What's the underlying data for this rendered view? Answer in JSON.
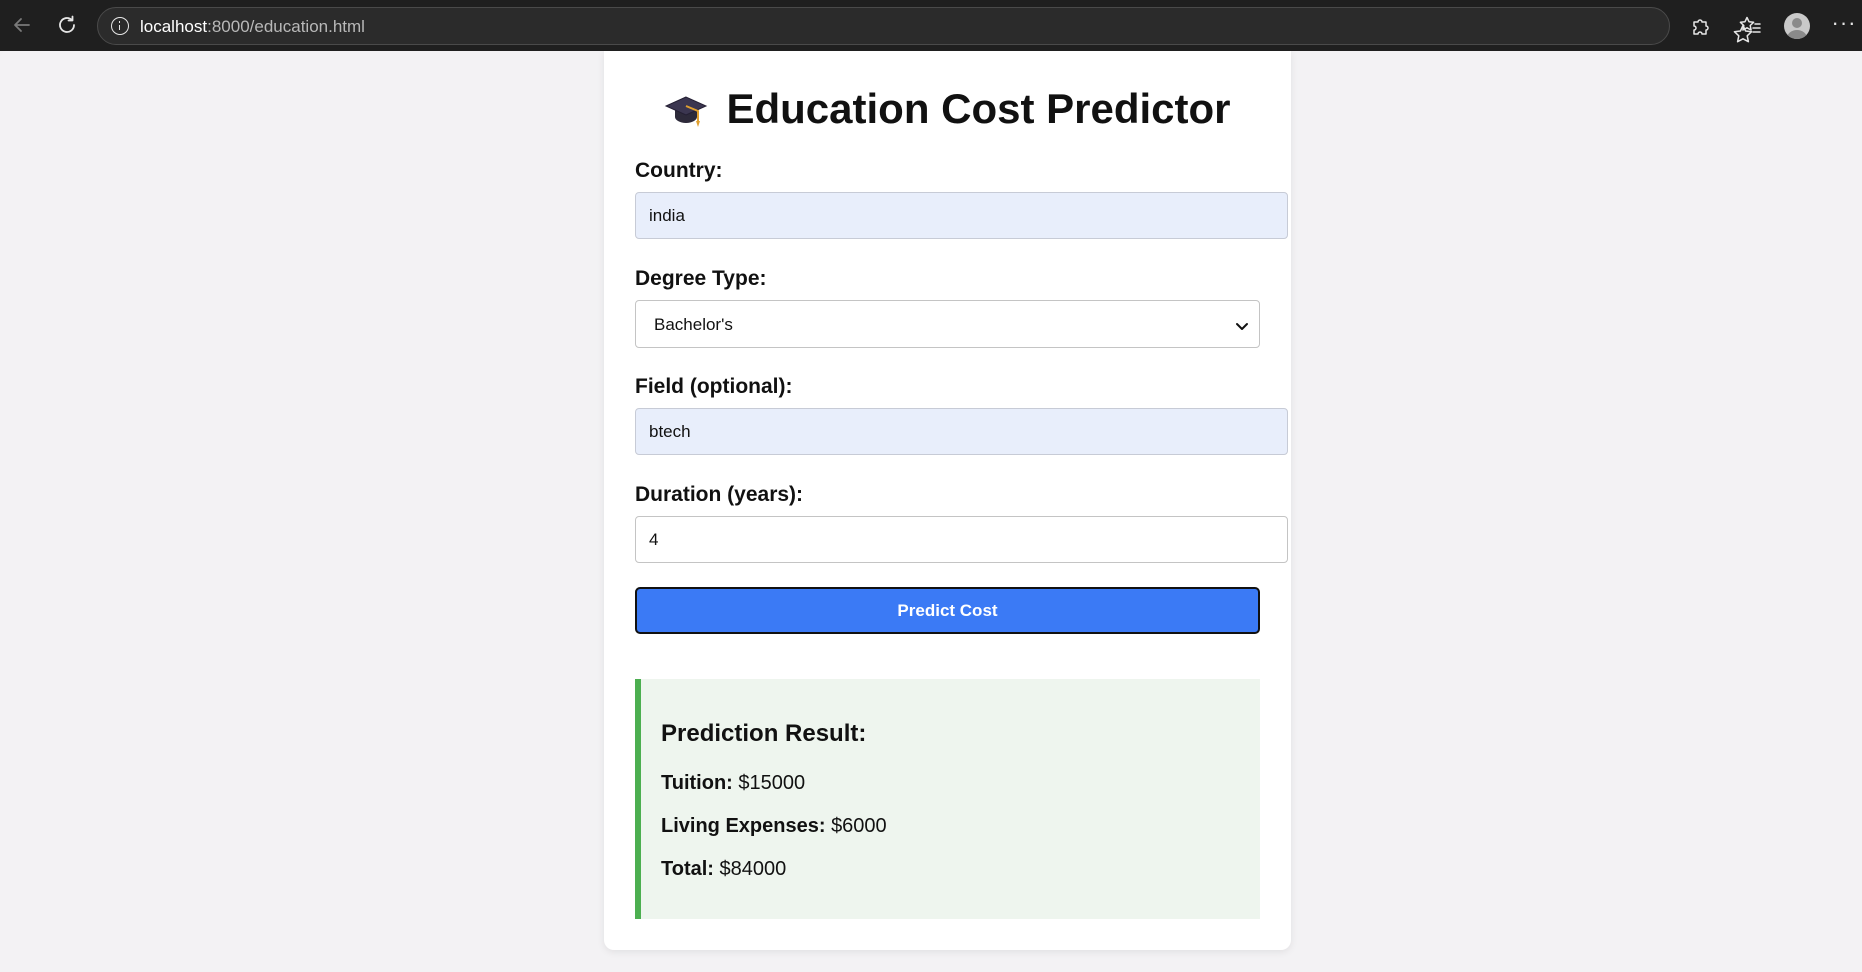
{
  "browser": {
    "url_host": "localhost",
    "url_path": ":8000/education.html"
  },
  "page": {
    "title": "Education Cost Predictor",
    "title_icon": "graduation-cap-icon"
  },
  "form": {
    "country": {
      "label": "Country:",
      "value": "india"
    },
    "degree_type": {
      "label": "Degree Type:",
      "selected": "Bachelor's"
    },
    "field": {
      "label": "Field (optional):",
      "value": "btech"
    },
    "duration": {
      "label": "Duration (years):",
      "value": "4"
    },
    "submit_label": "Predict Cost"
  },
  "result": {
    "heading": "Prediction Result:",
    "tuition": {
      "label": "Tuition:",
      "value": "$15000"
    },
    "living": {
      "label": "Living Expenses:",
      "value": "$6000"
    },
    "total": {
      "label": "Total:",
      "value": "$84000"
    }
  },
  "colors": {
    "button": "#3b7af5",
    "result_accent": "#4caf50",
    "result_bg": "#eef5ee",
    "autofill_bg": "#e8eefb"
  }
}
